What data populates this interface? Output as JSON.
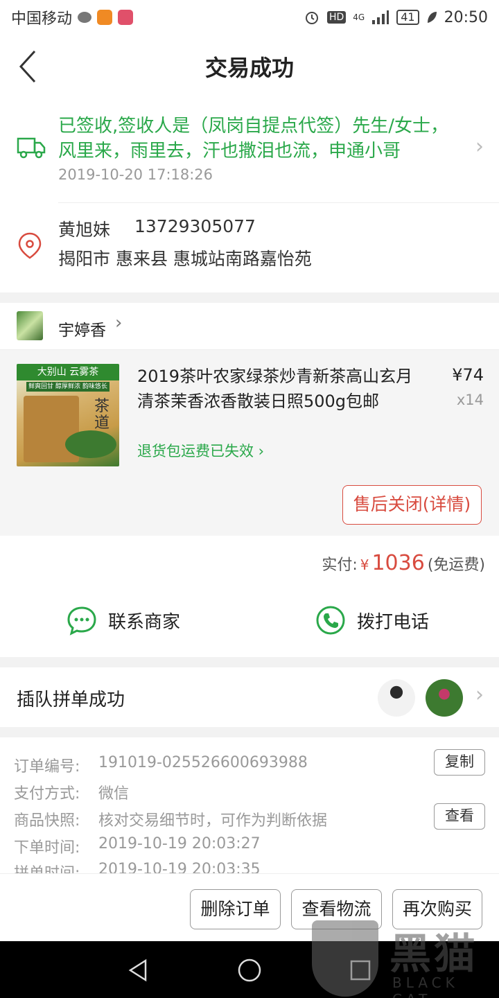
{
  "status_bar": {
    "carrier": "中国移动",
    "hd": "HD",
    "network": "4G",
    "battery": "41",
    "time": "20:50"
  },
  "header": {
    "title": "交易成功"
  },
  "logistics": {
    "text": "已签收,签收人是（凤岗自提点代签）先生/女士，风里来，雨里去，汗也撒泪也流，申通小哥",
    "time": "2019-10-20 17:18:26"
  },
  "address": {
    "name": "黄旭妹",
    "phone": "13729305077",
    "line": "揭阳市 惠来县 惠城站南路嘉怡苑"
  },
  "shop": {
    "name": "宇婷香",
    "chevron": "›"
  },
  "product": {
    "image_band": "大别山 云雾茶",
    "image_tagline": "鲜爽回甘 醇厚鲜浓 韵味悠长",
    "image_cha": "茶道",
    "title": "2019茶叶农家绿茶炒青新茶高山玄月清茶茉香浓香散装日照500g包邮",
    "price": "¥74",
    "quantity": "x14",
    "return_note": "退货包运费已失效",
    "after_sale_button": "售后关闭(详情)"
  },
  "payment": {
    "label": "实付:",
    "currency": "¥",
    "amount": "1036",
    "shipping_note": "(免运费)"
  },
  "contact": {
    "merchant": "联系商家",
    "call": "拨打电话"
  },
  "group_order": {
    "text": "插队拼单成功"
  },
  "order_info": {
    "rows": [
      {
        "key": "订单编号:",
        "value": "191019-025526600693988"
      },
      {
        "key": "支付方式:",
        "value": "微信"
      },
      {
        "key": "商品快照:",
        "value": "核对交易细节时，可作为判断依据"
      },
      {
        "key": "下单时间:",
        "value": "2019-10-19 20:03:27"
      },
      {
        "key": "拼单时间:",
        "value": "2019-10-19 20:03:35"
      }
    ],
    "copy_button": "复制",
    "view_button": "查看"
  },
  "actions": {
    "delete": "删除订单",
    "logistics": "查看物流",
    "buy_again": "再次购买"
  },
  "watermark": {
    "text": "黑猫",
    "sub": "BLACK CAT"
  },
  "colors": {
    "green": "#2aa84a",
    "red": "#d84b3f"
  }
}
